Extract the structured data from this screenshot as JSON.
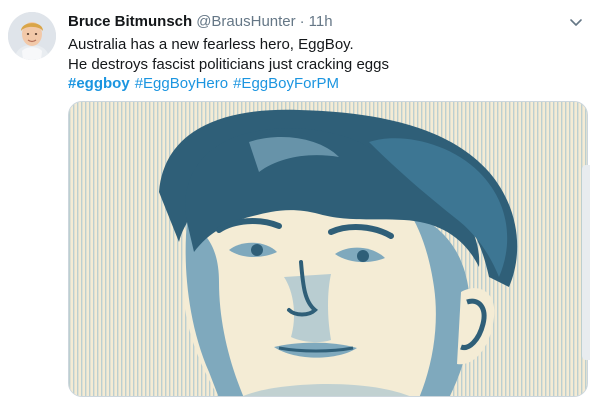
{
  "tweet": {
    "author": {
      "name": "Bruce Bitmunsch",
      "handle": "@BrausHunter",
      "separator": "·",
      "time": "11h"
    },
    "text": {
      "line1": "Australia has a new fearless hero, EggBoy.",
      "line2": "He destroys fascist politicians just cracking eggs"
    },
    "hashtags": [
      "#eggboy",
      "#EggBoyHero",
      "#EggBoyForPM"
    ],
    "icons": {
      "menu": "chevron-down-icon",
      "avatar": "avatar"
    },
    "colors": {
      "link": "#1b95e0",
      "text": "#14171a",
      "muted": "#657786",
      "poster_dark": "#2f5f78",
      "poster_mid": "#7fa9bd",
      "poster_light": "#f4ecd5"
    }
  }
}
